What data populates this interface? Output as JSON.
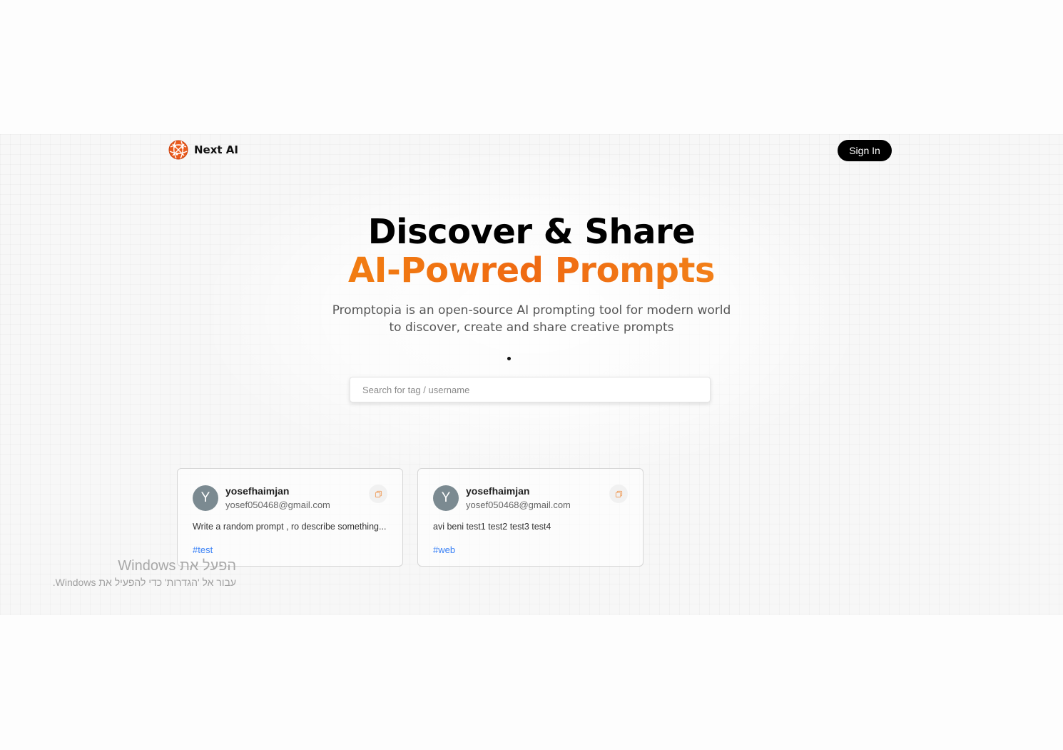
{
  "nav": {
    "brand": "Next AI",
    "logo_icon": "globe-logo-icon",
    "signin_label": "Sign In"
  },
  "hero": {
    "title_line1": "Discover & Share",
    "title_line2": "AI-Powred Prompts",
    "description": "Promptopia is an open-source AI prompting tool for modern world to discover, create and share creative prompts"
  },
  "search": {
    "placeholder": "Search for tag / username",
    "value": ""
  },
  "prompts": [
    {
      "avatar_letter": "Y",
      "username": "yosefhaimjan",
      "email": "yosef050468@gmail.com",
      "prompt": "Write a random prompt , ro describe something...",
      "tag": "#test",
      "copy_icon": "copy-icon"
    },
    {
      "avatar_letter": "Y",
      "username": "yosefhaimjan",
      "email": "yosef050468@gmail.com",
      "prompt": "avi beni test1 test2 test3 test4",
      "tag": "#web",
      "copy_icon": "copy-icon"
    }
  ],
  "watermark": {
    "line1": "הפעל את Windows",
    "line2": "עבור אל 'הגדרות' כדי להפעיל את Windows."
  },
  "colors": {
    "accent_start": "#f6a013",
    "accent_mid": "#ef6a12",
    "tag_blue": "#3b82f6",
    "button_black": "#000000"
  }
}
